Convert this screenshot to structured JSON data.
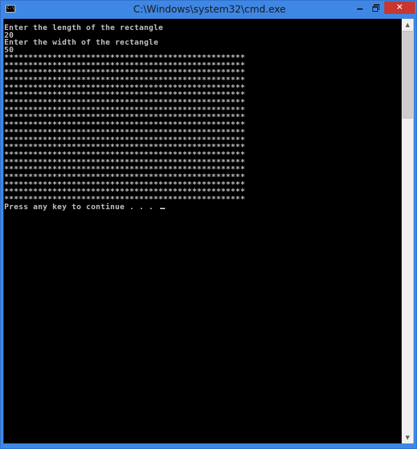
{
  "window": {
    "title": "C:\\Windows\\system32\\cmd.exe",
    "icon": "cmd-prompt-icon",
    "icon_text": "C:\\_",
    "buttons": {
      "minimize": "minimize-icon",
      "maximize": "restore-icon",
      "close_label": "✕"
    },
    "frame_color": "#3f87e4",
    "close_color": "#c7372f"
  },
  "console": {
    "background": "#000000",
    "foreground": "#c0c0c0",
    "lines": [
      "Enter the length of the rectangle",
      "20",
      "Enter the width of the rectangle",
      "50",
      "**************************************************",
      "**************************************************",
      "**************************************************",
      "**************************************************",
      "**************************************************",
      "**************************************************",
      "**************************************************",
      "**************************************************",
      "**************************************************",
      "**************************************************",
      "**************************************************",
      "**************************************************",
      "**************************************************",
      "**************************************************",
      "**************************************************",
      "**************************************************",
      "**************************************************",
      "**************************************************",
      "**************************************************",
      "**************************************************",
      "Press any key to continue . . ."
    ]
  },
  "scrollbar": {
    "up_arrow": "▲",
    "down_arrow": "▼"
  }
}
